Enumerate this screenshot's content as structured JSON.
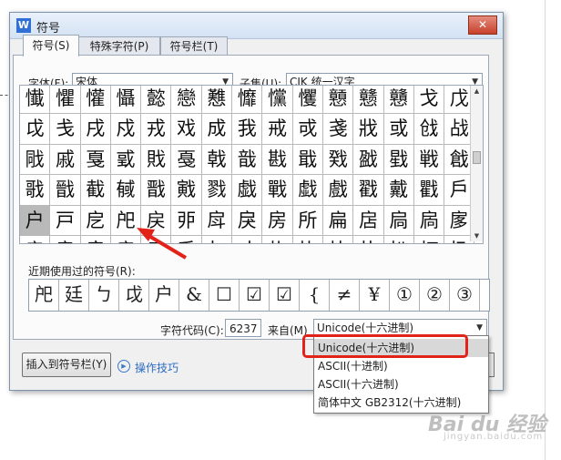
{
  "window": {
    "title": "符号",
    "app_icon_glyph": "W",
    "close_glyph": "✕"
  },
  "tabs": [
    {
      "label": "符号(S)",
      "active": true
    },
    {
      "label": "特殊字符(P)",
      "active": false
    },
    {
      "label": "符号栏(T)",
      "active": false
    }
  ],
  "font": {
    "label": "字体(F):",
    "value": "宋体"
  },
  "subset": {
    "label": "子集(U):",
    "value": "CJK 统一汉字"
  },
  "grid": {
    "rows": [
      [
        "懴",
        "懼",
        "懽",
        "懾",
        "懿",
        "戀",
        "戁",
        "戂",
        "戃",
        "戄",
        "戅",
        "戆",
        "戇",
        "戈",
        "戊"
      ],
      [
        "戉",
        "戋",
        "戌",
        "戍",
        "戎",
        "戏",
        "成",
        "我",
        "戒",
        "戓",
        "戔",
        "戕",
        "或",
        "戗",
        "战"
      ],
      [
        "戙",
        "戚",
        "戛",
        "戜",
        "戝",
        "戞",
        "戟",
        "戠",
        "戡",
        "戢",
        "戣",
        "戤",
        "戥",
        "戦",
        "戧"
      ],
      [
        "戨",
        "戩",
        "截",
        "戫",
        "戬",
        "戭",
        "戮",
        "戯",
        "戰",
        "戱",
        "戲",
        "戳",
        "戴",
        "戵",
        "戶"
      ],
      [
        "户",
        "戸",
        "戹",
        "戺",
        "戻",
        "戼",
        "戽",
        "戾",
        "房",
        "所",
        "扁",
        "扂",
        "扃",
        "扄",
        "扅"
      ],
      [
        "扆",
        "扇",
        "扈",
        "扉",
        "扊",
        "手",
        "扌",
        "才",
        "扎",
        "扏",
        "扐",
        "扑",
        "扒",
        "打",
        "扔"
      ]
    ],
    "selected_row": 4,
    "selected_col": 0
  },
  "recent": {
    "label": "近期使用过的符号(R):",
    "symbols": [
      "戺",
      "廷",
      "ㄅ",
      "戉",
      "户",
      "&",
      "☐",
      "☑",
      "☑",
      "{",
      "≠",
      "¥",
      "①",
      "②",
      "③"
    ]
  },
  "char_code": {
    "label": "字符代码(C):",
    "value": "6237"
  },
  "from": {
    "label": "来自(M)",
    "value": "Unicode(十六进制)",
    "options": [
      "Unicode(十六进制)",
      "ASCII(十进制)",
      "ASCII(十六进制)",
      "简体中文 GB2312(十六进制)"
    ],
    "highlighted_index": 0
  },
  "buttons": {
    "insert": "插入到符号栏(Y)",
    "tips": "操作技巧"
  },
  "watermark": {
    "text": "Bai du 经验",
    "sub": "jingyan.baidu.com"
  },
  "colors": {
    "annotation_red": "#e2231a",
    "link_blue": "#2e6cc2",
    "selected_cell": "#b9b9b9"
  }
}
